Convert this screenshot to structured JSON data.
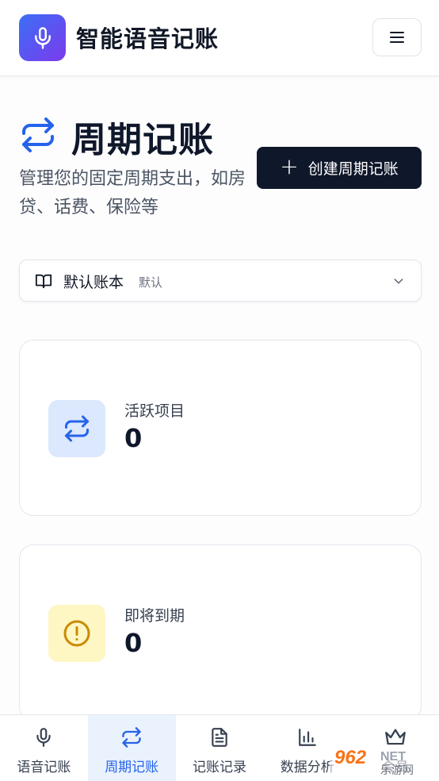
{
  "header": {
    "app_title": "智能语音记账",
    "logo_icon": "microphone-icon",
    "menu_icon": "hamburger-menu-icon"
  },
  "page": {
    "title": "周期记账",
    "title_icon": "repeat-arrows-icon",
    "description": "管理您的固定周期支出，如房贷、话费、保险等",
    "create_button_label": "创建周期记账"
  },
  "account_book": {
    "name": "默认账本",
    "tag": "默认",
    "icon": "book-open-icon"
  },
  "stats": [
    {
      "label": "活跃项目",
      "value": "0",
      "icon": "repeat-arrows-icon",
      "color": "#2563eb",
      "bg": "#dbe8fd"
    },
    {
      "label": "即将到期",
      "value": "0",
      "icon": "alert-circle-icon",
      "color": "#ca8a04",
      "bg": "#fef6c3"
    }
  ],
  "bottom_nav": [
    {
      "label": "语音记账",
      "icon": "microphone-icon",
      "active": false
    },
    {
      "label": "周期记账",
      "icon": "repeat-arrows-icon",
      "active": true
    },
    {
      "label": "记账记录",
      "icon": "document-icon",
      "active": false
    },
    {
      "label": "数据分析",
      "icon": "bar-chart-icon",
      "active": false
    },
    {
      "label": "会员",
      "icon": "crown-icon",
      "active": false
    }
  ],
  "watermark": {
    "brand": "962",
    "suffix": "NET",
    "sub": "乐游网"
  },
  "colors": {
    "accent": "#2563eb",
    "primary_button": "#0f172a",
    "warning": "#ca8a04"
  }
}
